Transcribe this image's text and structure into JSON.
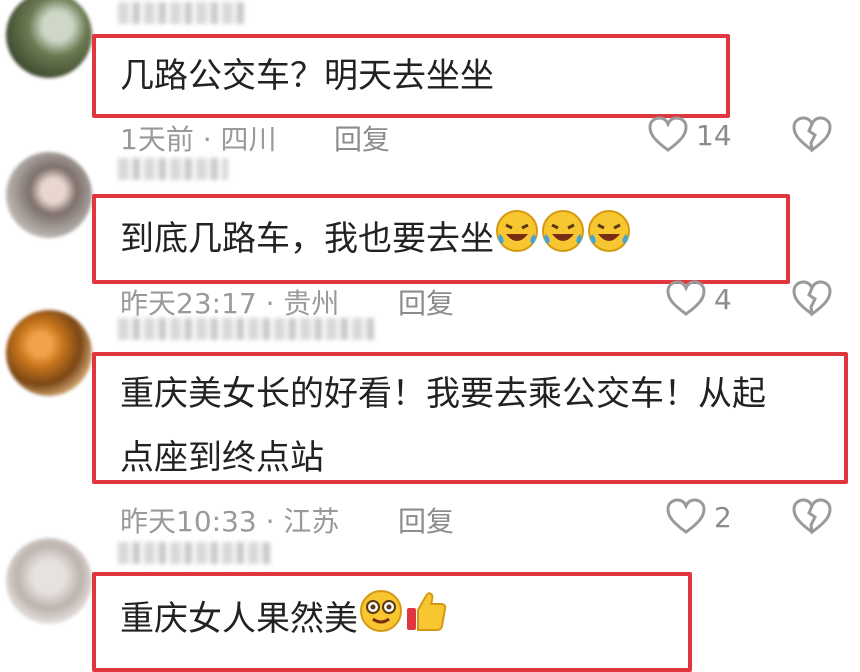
{
  "comments": [
    {
      "text": "几路公交车？明天去坐坐",
      "meta": "1天前 · 四川",
      "reply_label": "回复",
      "likes": "14"
    },
    {
      "text": "到底几路车，我也要去坐",
      "meta": "昨天23:17 · 贵州",
      "reply_label": "回复",
      "likes": "4"
    },
    {
      "text_line1": "重庆美女长的好看！我要去乘公交车！从起",
      "text_line2": "点座到终点站",
      "meta": "昨天10:33 · 江苏",
      "reply_label": "回复",
      "likes": "2"
    },
    {
      "text": "重庆女人果然美"
    }
  ],
  "colors": {
    "highlight_border": "#e0363f",
    "meta_text": "#9a9a9a",
    "body_text": "#222222"
  },
  "icons": [
    "heart-outline-icon",
    "broken-heart-icon",
    "laughing-crying-emoji-icon",
    "starry-eyes-emoji-icon",
    "thumbs-up-emoji-icon"
  ]
}
